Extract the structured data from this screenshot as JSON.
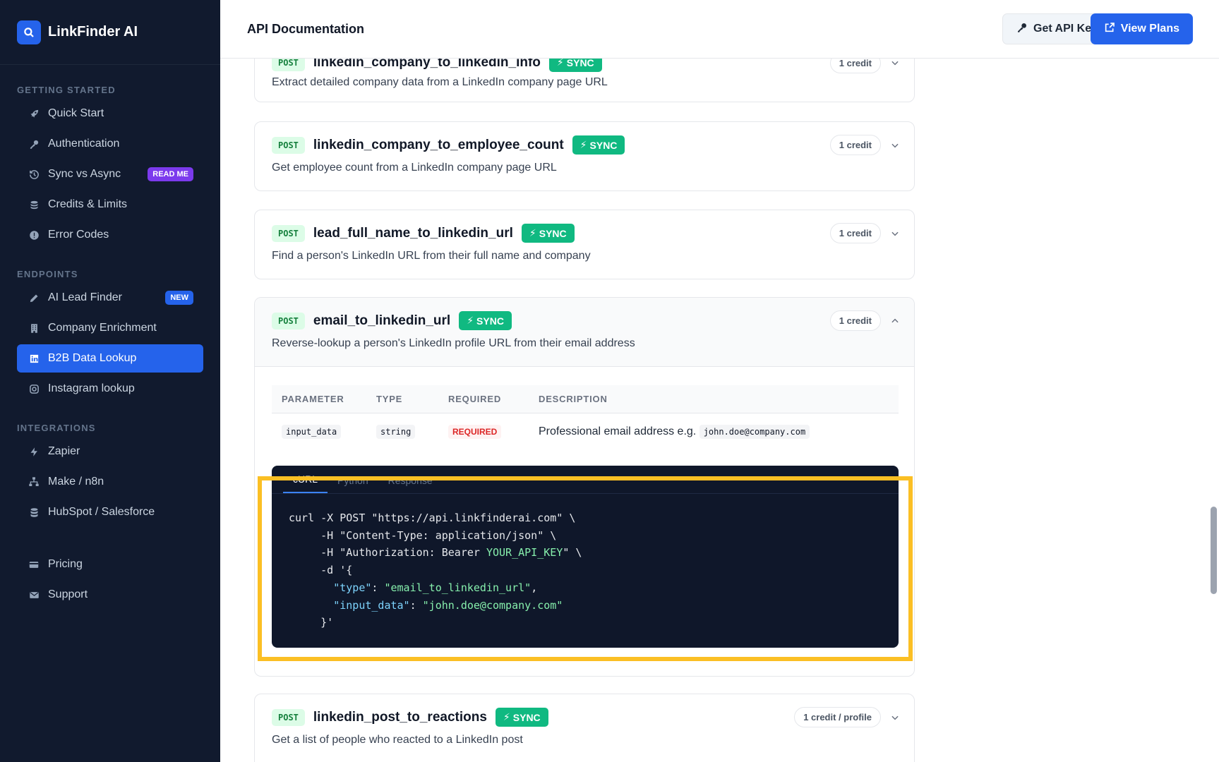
{
  "app": {
    "name": "LinkFinder AI"
  },
  "header": {
    "title": "API Documentation",
    "get_api_key": "Get API Key",
    "view_plans": "View Plans"
  },
  "sidebar": {
    "sections": [
      {
        "label": "GETTING STARTED",
        "items": [
          {
            "label": "Quick Start",
            "icon": "rocket-icon"
          },
          {
            "label": "Authentication",
            "icon": "key-icon"
          },
          {
            "label": "Sync vs Async",
            "icon": "history-icon",
            "badge": "READ ME"
          },
          {
            "label": "Credits & Limits",
            "icon": "coins-icon"
          },
          {
            "label": "Error Codes",
            "icon": "alert-icon"
          }
        ]
      },
      {
        "label": "ENDPOINTS",
        "items": [
          {
            "label": "AI Lead Finder",
            "icon": "pen-icon",
            "badge": "NEW"
          },
          {
            "label": "Company Enrichment",
            "icon": "building-icon"
          },
          {
            "label": "B2B Data Lookup",
            "icon": "linkedin-icon",
            "active": true
          },
          {
            "label": "Instagram lookup",
            "icon": "instagram-icon"
          }
        ]
      },
      {
        "label": "INTEGRATIONS",
        "items": [
          {
            "label": "Zapier",
            "icon": "bolt-icon"
          },
          {
            "label": "Make / n8n",
            "icon": "network-icon"
          },
          {
            "label": "HubSpot / Salesforce",
            "icon": "database-icon"
          }
        ]
      },
      {
        "label": "",
        "items": [
          {
            "label": "Pricing",
            "icon": "card-icon"
          },
          {
            "label": "Support",
            "icon": "mail-icon"
          }
        ]
      }
    ]
  },
  "endpoints": [
    {
      "method": "POST",
      "name": "linkedin_company_to_linkedin_info",
      "mode": "SYNC",
      "description": "Extract detailed company data from a LinkedIn company page URL",
      "credit": "1 credit"
    },
    {
      "method": "POST",
      "name": "linkedin_company_to_employee_count",
      "mode": "SYNC",
      "description": "Get employee count from a LinkedIn company page URL",
      "credit": "1 credit"
    },
    {
      "method": "POST",
      "name": "lead_full_name_to_linkedin_url",
      "mode": "SYNC",
      "description": "Find a person's LinkedIn URL from their full name and company",
      "credit": "1 credit"
    },
    {
      "method": "POST",
      "name": "email_to_linkedin_url",
      "mode": "SYNC",
      "description": "Reverse-lookup a person's LinkedIn profile URL from their email address",
      "credit": "1 credit"
    },
    {
      "method": "POST",
      "name": "linkedin_post_to_reactions",
      "mode": "SYNC",
      "description": "Get a list of people who reacted to a LinkedIn post",
      "credit": "1 credit / profile"
    }
  ],
  "params_table": {
    "headers": [
      "PARAMETER",
      "TYPE",
      "REQUIRED",
      "DESCRIPTION"
    ],
    "rows": [
      {
        "parameter": "input_data",
        "type": "string",
        "required": "REQUIRED",
        "description": "Professional email address e.g.",
        "example": "john.doe@company.com"
      }
    ]
  },
  "code": {
    "tabs": [
      "cURL",
      "Python",
      "Response"
    ],
    "active_tab": "cURL",
    "lines": {
      "l1": "curl -X POST \"https://api.linkfinderai.com\" \\",
      "l2": "     -H \"Content-Type: application/json\" \\",
      "l3a": "     -H \"Authorization: Bearer ",
      "l3b": "YOUR_API_KEY",
      "l3c": "\" \\",
      "l4": "     -d '{",
      "l5a": "       \"type\"",
      "l5b": "\"email_to_linkedin_url\"",
      "l6a": "       \"input_data\"",
      "l6b": "\"john.doe@company.com\"",
      "l7": "     }'"
    }
  },
  "colors": {
    "sidebar_bg": "#111a2e",
    "accent": "#2563eb",
    "sync_green": "#10b981",
    "highlight": "#fbbf24"
  }
}
